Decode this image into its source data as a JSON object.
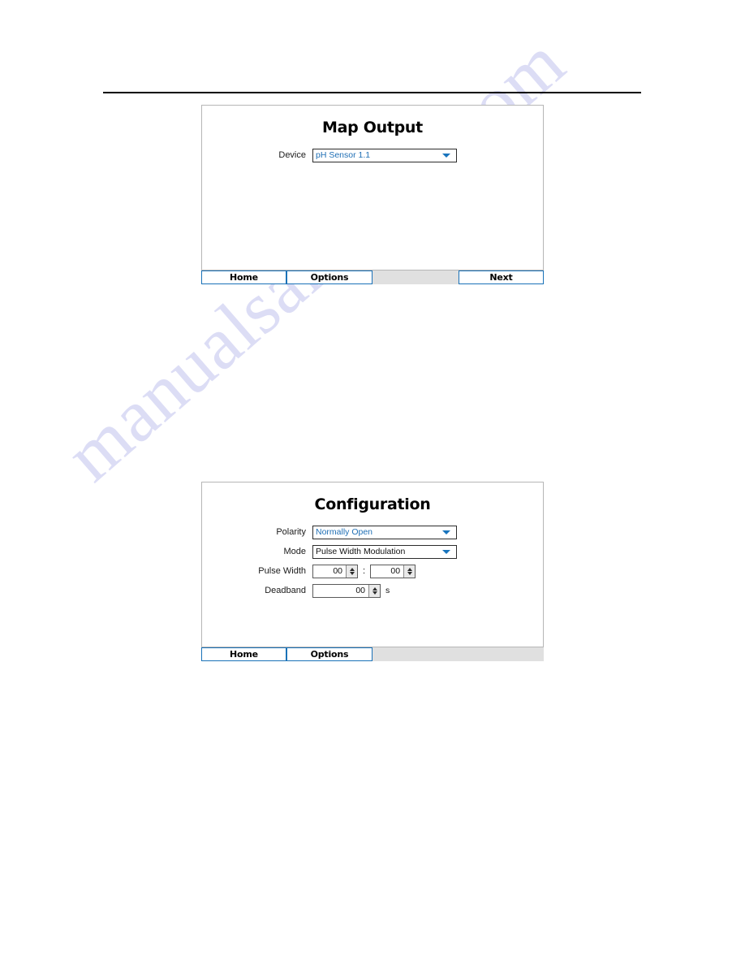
{
  "page": {
    "watermark": "manualsarchive.com"
  },
  "screens": [
    {
      "id": "map-output",
      "title": "Map Output",
      "fields": [
        {
          "type": "combo",
          "label": "Device",
          "value": "pH Sensor 1.1",
          "value_style": "selected",
          "arrow": "chevron-down-icon"
        }
      ],
      "buttons": [
        {
          "label": "Home"
        },
        {
          "label": "Options"
        },
        {
          "label": ""
        },
        {
          "label": "Next"
        }
      ]
    },
    {
      "id": "configuration",
      "title": "Configuration",
      "fields": [
        {
          "type": "combo",
          "label": "Polarity",
          "value": "Normally Open",
          "value_style": "selected",
          "arrow": "chevron-down-icon"
        },
        {
          "type": "combo",
          "label": "Mode",
          "value": "Pulse Width Modulation",
          "value_style": "plain",
          "arrow": "chevron-down-icon"
        },
        {
          "type": "spin-pair",
          "label": "Pulse Width",
          "value_a": "00",
          "separator": ":",
          "value_b": "00"
        },
        {
          "type": "spin-unit",
          "label": "Deadband",
          "value": "00",
          "unit": "s"
        }
      ],
      "buttons": [
        {
          "label": "Home"
        },
        {
          "label": "Options"
        },
        {
          "label": ""
        }
      ]
    }
  ],
  "colors": {
    "accent_blue": "#1a72b8",
    "value_blue": "#1f6fb5",
    "bar_gray": "#e0e0e0",
    "panel_border": "#b6b6b6",
    "watermark": "#cfd0f2"
  }
}
